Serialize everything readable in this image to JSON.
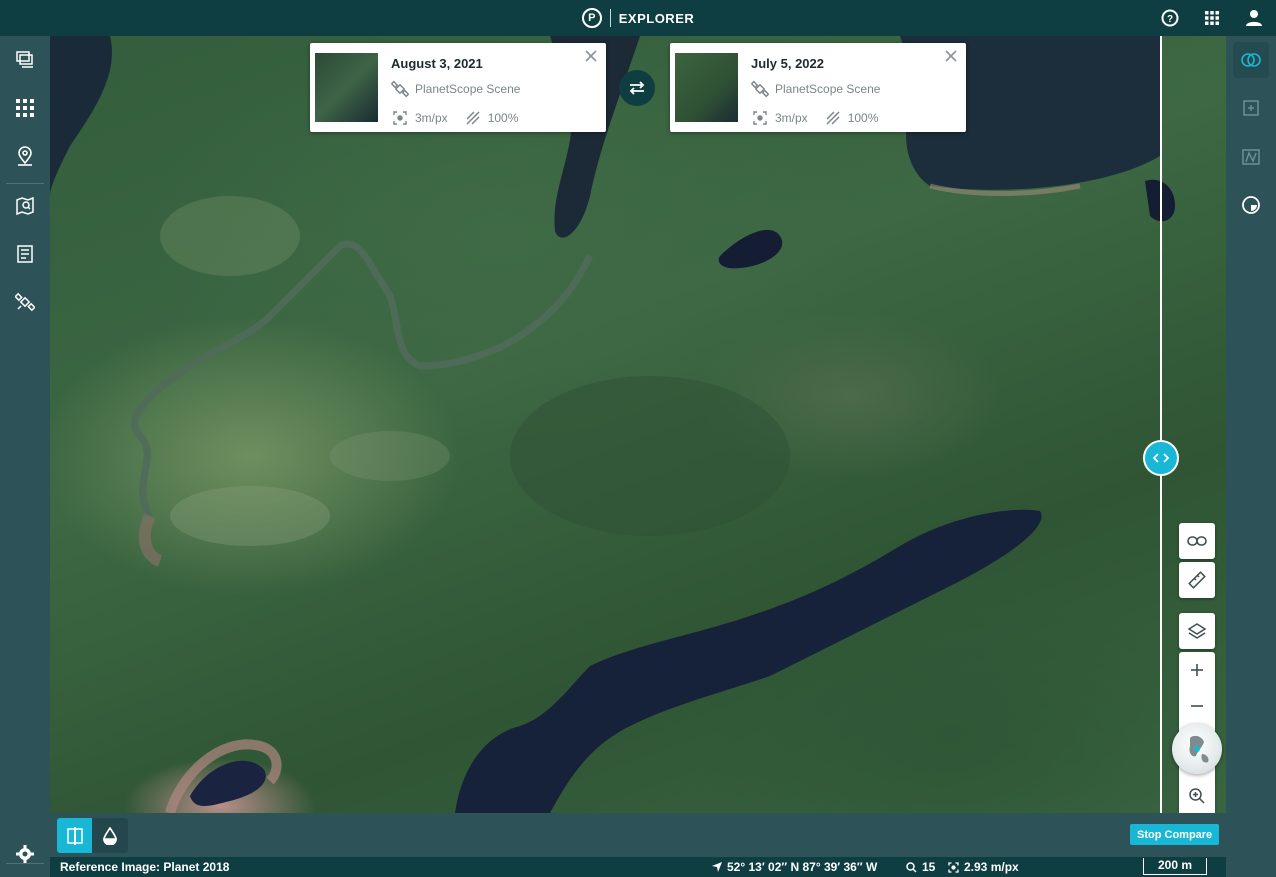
{
  "app": {
    "logo_letter": "P",
    "title": "EXPLORER"
  },
  "topbar": {
    "icons": [
      "help-icon",
      "apps-grid-icon",
      "user-icon"
    ]
  },
  "left_sidebar": {
    "items": [
      "layers-stack-icon",
      "grid-search-icon",
      "location-pin-icon",
      "map-search-icon",
      "list-document-icon",
      "satellite-icon"
    ],
    "settings_icon": "gear-icon"
  },
  "right_sidebar": {
    "items": [
      "compare-icon",
      "add-image-icon",
      "spectral-icon",
      "timelapse-icon"
    ]
  },
  "compare": {
    "left": {
      "date": "August 3, 2021",
      "source": "PlanetScope Scene",
      "resolution": "3m/px",
      "coverage": "100%"
    },
    "right": {
      "date": "July 5, 2022",
      "source": "PlanetScope Scene",
      "resolution": "3m/px",
      "coverage": "100%"
    }
  },
  "map_controls": [
    "link-icon",
    "ruler-icon",
    "layers-icon",
    "zoom-in-icon",
    "zoom-out-icon",
    "globe-icon",
    "zoom-search-icon"
  ],
  "bottom_toolbar": {
    "stop_compare_label": "Stop Compare"
  },
  "status": {
    "reference": "Reference Image: Planet 2018",
    "coordinates": "52° 13′ 02″ N 87° 39′ 36″ W",
    "zoom": "15",
    "resolution": "2.93 m/px",
    "scale": "200 m"
  },
  "colors": {
    "accent": "#19b7d6",
    "header": "#0e3d42",
    "sidebar": "#2d5257"
  }
}
